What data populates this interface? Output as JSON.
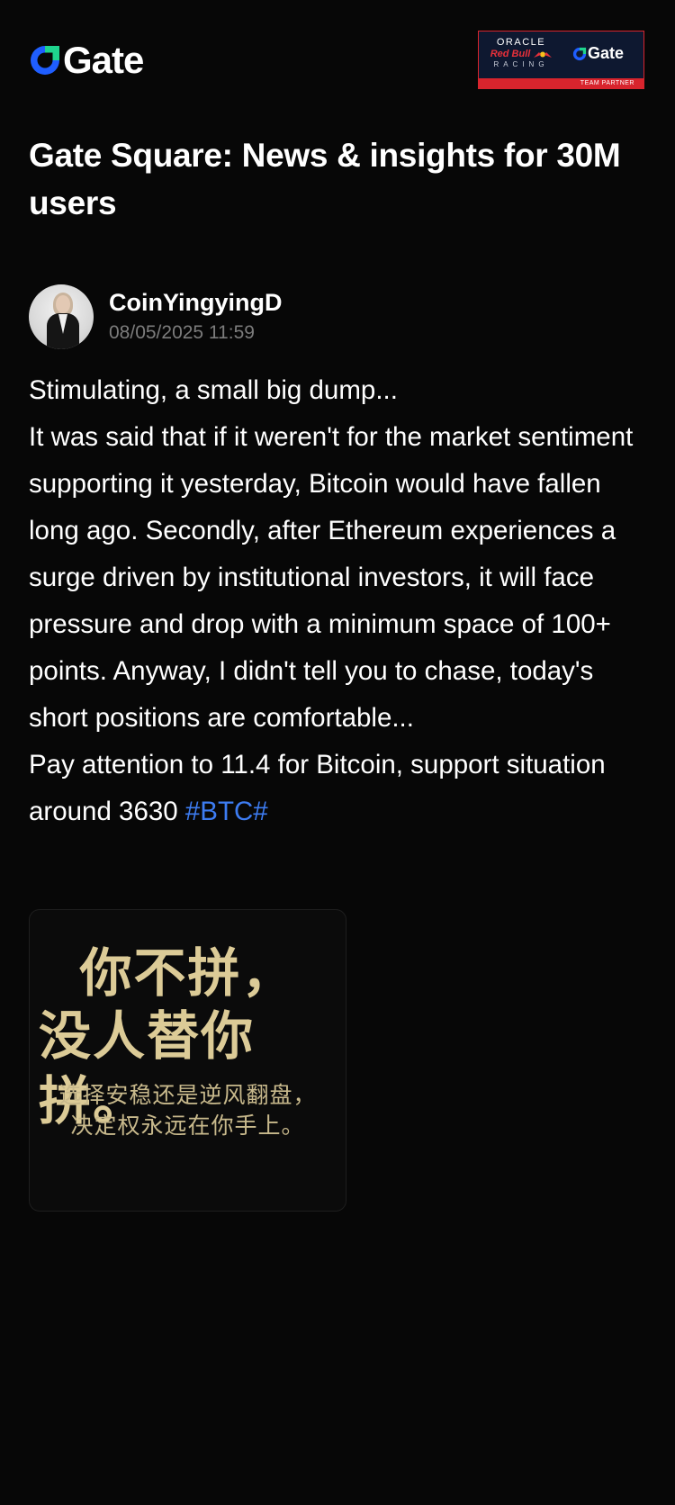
{
  "brand": {
    "logo_text": "Gate",
    "accent_color": "#1f5eff",
    "logo_icon": "gate-logo-icon"
  },
  "partner_badge": {
    "oracle": "ORACLE",
    "redbull": "Red Bull",
    "racing": "RACING",
    "gate_text": "Gate",
    "strip_text": "TEAM PARTNER",
    "strip_color": "#d8242d"
  },
  "page": {
    "title": "Gate Square: News & insights for 30M users"
  },
  "post": {
    "author_name": "CoinYingyingD",
    "timestamp": "08/05/2025 11:59",
    "body": "Stimulating, a small big dump...\nIt was said that if it weren't for the market sentiment supporting it yesterday, Bitcoin would have fallen long ago. Secondly, after Ethereum experiences a surge driven by institutional investors, it will face pressure and drop with a minimum space of 100+ points. Anyway, I didn't tell you to chase, today's short positions are comfortable...\nPay attention to 11.4 for Bitcoin, support situation around 3630 ",
    "hashtag": "#BTC#",
    "hashtag_color": "#3d7cf2",
    "image": {
      "line1": "你不拼，",
      "line2": "没人替你拼。",
      "line3": "选择安稳还是逆风翻盘，",
      "line4": "决定权永远在你手上。"
    }
  }
}
